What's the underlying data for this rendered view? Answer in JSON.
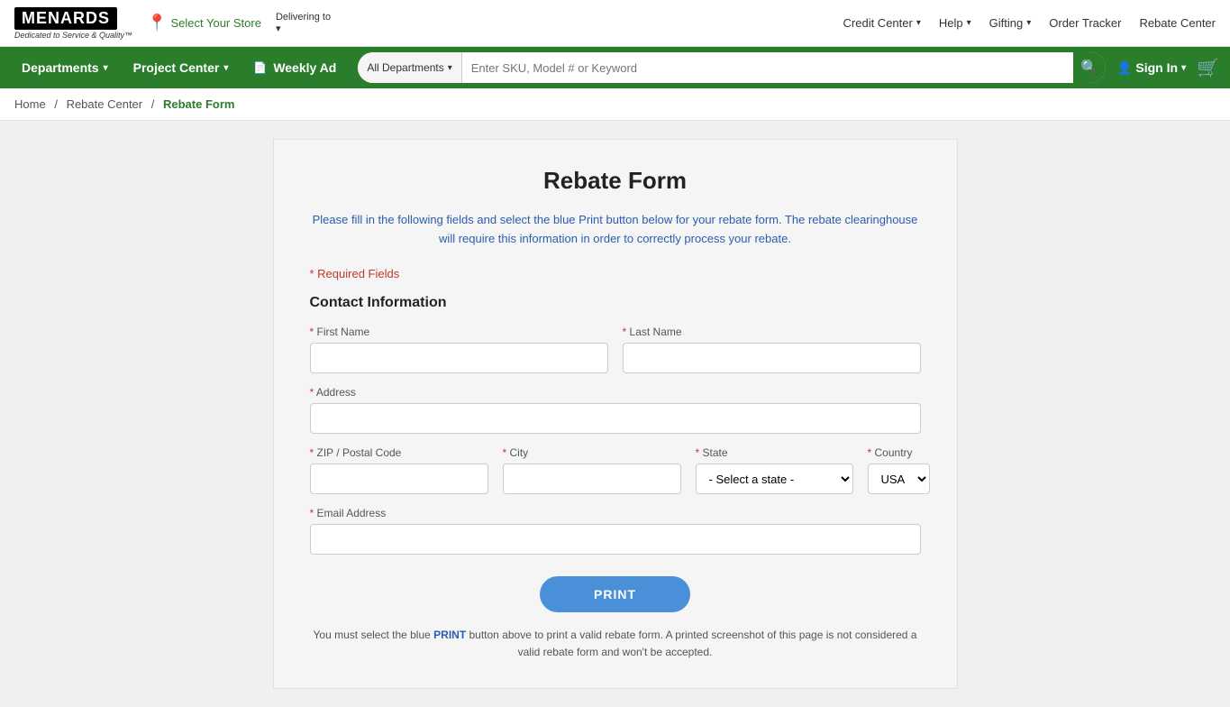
{
  "brand": {
    "name": "MENARDS",
    "tagline": "Dedicated to Service & Quality™"
  },
  "topbar": {
    "store_select": "Select Your Store",
    "delivering_to": "Delivering to",
    "delivering_chevron": "▾",
    "nav_links": [
      {
        "label": "Credit Center",
        "has_chevron": true
      },
      {
        "label": "Help",
        "has_chevron": true
      },
      {
        "label": "Gifting",
        "has_chevron": true
      },
      {
        "label": "Order Tracker",
        "has_chevron": false
      },
      {
        "label": "Rebate Center",
        "has_chevron": false
      }
    ]
  },
  "navbar": {
    "items": [
      {
        "label": "Departments",
        "has_chevron": true
      },
      {
        "label": "Project Center",
        "has_chevron": true
      },
      {
        "label": "Weekly Ad",
        "has_icon": true,
        "has_chevron": false
      }
    ],
    "search": {
      "category": "All Departments",
      "placeholder": "Enter SKU, Model # or Keyword"
    },
    "signin": "Sign In",
    "cart_icon": "🛒"
  },
  "breadcrumb": {
    "items": [
      {
        "label": "Home",
        "link": true
      },
      {
        "label": "Rebate Center",
        "link": true
      },
      {
        "label": "Rebate Form",
        "current": true
      }
    ]
  },
  "form": {
    "title": "Rebate Form",
    "description": "Please fill in the following fields and select the blue Print button below for your rebate form. The rebate clearinghouse will require this information in order to correctly process your rebate.",
    "required_note": "* Required Fields",
    "section_title": "Contact Information",
    "fields": {
      "first_name_label": "First Name",
      "last_name_label": "Last Name",
      "address_label": "Address",
      "zip_label": "ZIP / Postal Code",
      "city_label": "City",
      "state_label": "State",
      "country_label": "Country",
      "email_label": "Email Address",
      "state_placeholder": "- Select a state -",
      "country_default": "USA"
    },
    "print_button": "PRINT",
    "print_note": "You must select the blue PRINT button above to print a valid rebate form. A printed screenshot of this page is not considered a valid rebate form and won't be accepted."
  }
}
